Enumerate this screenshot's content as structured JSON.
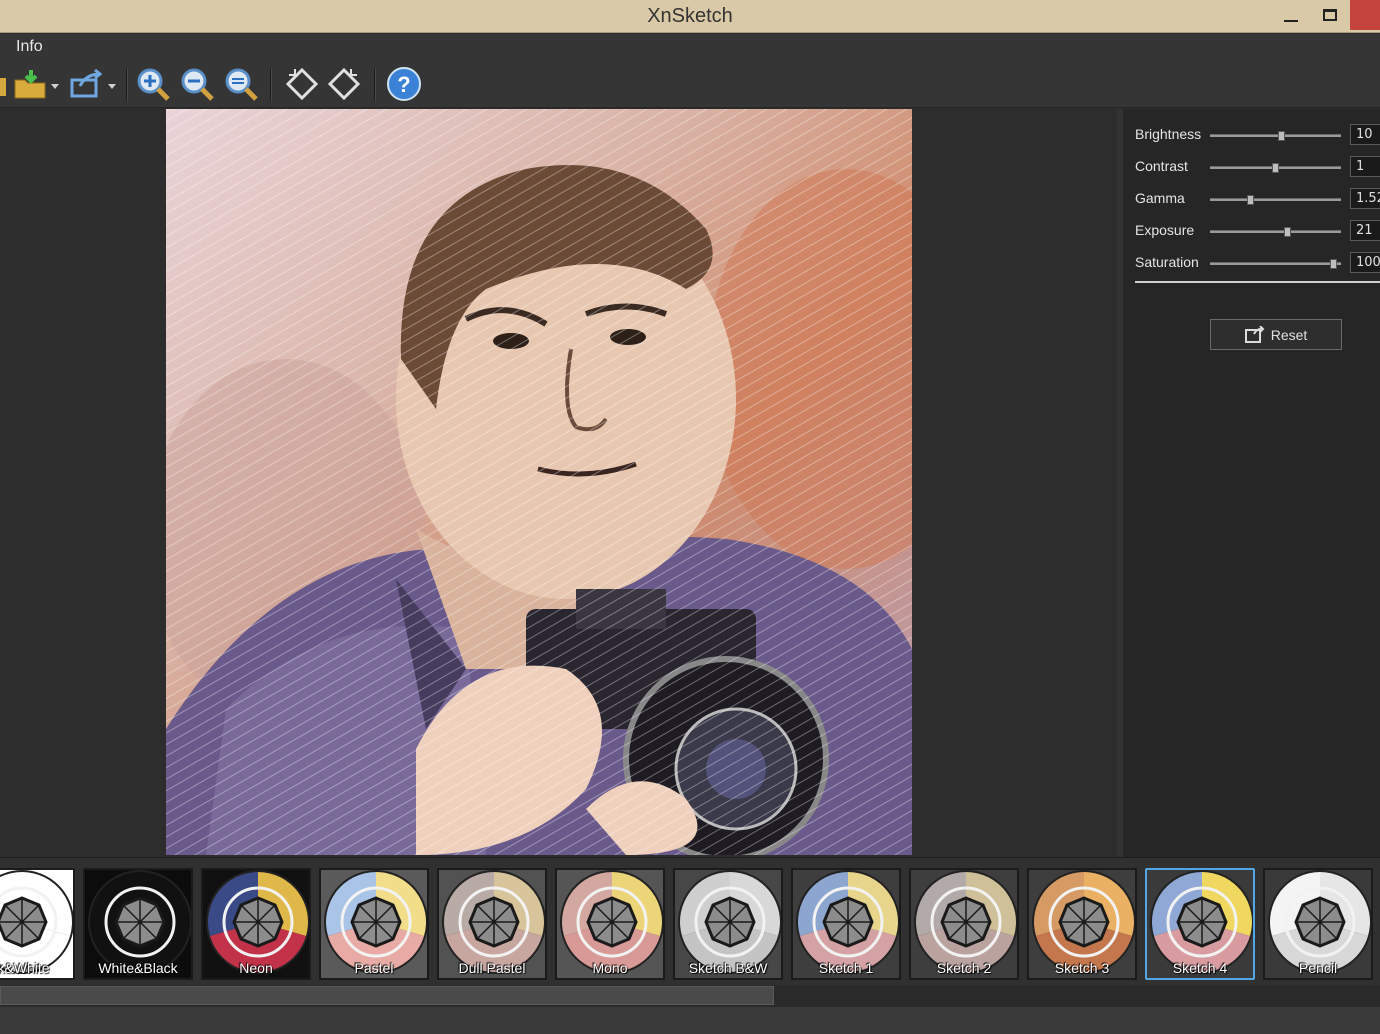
{
  "window": {
    "title": "XnSketch"
  },
  "menu": {
    "items": [
      "Info"
    ]
  },
  "toolbar": {
    "buttons": [
      "open-folder-icon",
      "import-icon",
      "export-icon",
      "zoom-in-icon",
      "zoom-out-icon",
      "zoom-fit-icon",
      "rotate-left-icon",
      "rotate-right-icon",
      "help-icon"
    ]
  },
  "panel": {
    "sliders": [
      {
        "label": "Brightness",
        "value": "10",
        "level": 0.55
      },
      {
        "label": "Contrast",
        "value": "1",
        "level": 0.5
      },
      {
        "label": "Gamma",
        "value": "1.52",
        "level": 0.3
      },
      {
        "label": "Exposure",
        "value": "21",
        "level": 0.6
      },
      {
        "label": "Saturation",
        "value": "100",
        "level": 0.97
      }
    ],
    "reset_label": "Reset"
  },
  "presets": [
    {
      "label": "ck&White",
      "colors": [
        "#ffffff",
        "#ffffff",
        "#ffffff"
      ],
      "bg": "#ffffff",
      "selected": false
    },
    {
      "label": "White&Black",
      "colors": [
        "#111111",
        "#111111",
        "#111111"
      ],
      "bg": "#0c0c0c",
      "selected": false
    },
    {
      "label": "Neon",
      "colors": [
        "#3a4a86",
        "#e0b84a",
        "#c2334a"
      ],
      "bg": "#101010",
      "selected": false
    },
    {
      "label": "Pastel",
      "colors": [
        "#a9c4e6",
        "#f1dd8a",
        "#e7aaa4"
      ],
      "bg": "#5a5a5a",
      "selected": false
    },
    {
      "label": "Dull Pastel",
      "colors": [
        "#b8aaa4",
        "#d8c49a",
        "#c8a6a0"
      ],
      "bg": "#525252",
      "selected": false
    },
    {
      "label": "Mono",
      "colors": [
        "#d2a8a0",
        "#ecd478",
        "#d89a96"
      ],
      "bg": "#555555",
      "selected": false
    },
    {
      "label": "Sketch B&W",
      "colors": [
        "#cfcfcf",
        "#d8d8d8",
        "#c4c4c4"
      ],
      "bg": "#474747",
      "selected": false
    },
    {
      "label": "Sketch 1",
      "colors": [
        "#8da6cf",
        "#e6d58a",
        "#d4a2a4"
      ],
      "bg": "#3e3e3e",
      "selected": false
    },
    {
      "label": "Sketch 2",
      "colors": [
        "#b2aaa8",
        "#cfc09a",
        "#baa29f"
      ],
      "bg": "#3e3e3e",
      "selected": false
    },
    {
      "label": "Sketch 3",
      "colors": [
        "#d69a64",
        "#eab064",
        "#c4764c"
      ],
      "bg": "#3e3e3e",
      "selected": false
    },
    {
      "label": "Sketch 4",
      "colors": [
        "#8fa8d6",
        "#f0d860",
        "#d89ca0"
      ],
      "bg": "#3a3a3a",
      "selected": true
    },
    {
      "label": "Pencil",
      "colors": [
        "#f4f4f4",
        "#e6e6e6",
        "#d8d8d8"
      ],
      "bg": "#3a3a3a",
      "selected": false
    }
  ]
}
